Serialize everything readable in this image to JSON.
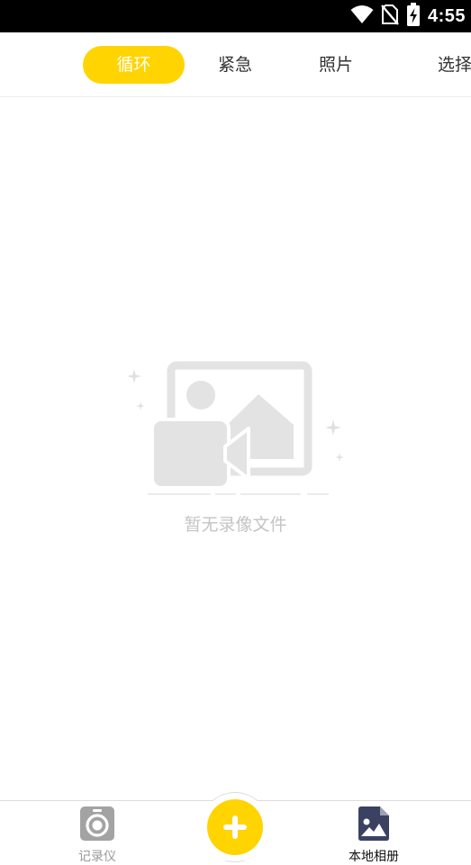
{
  "status_bar": {
    "time": "4:55",
    "icons": [
      "wifi-icon",
      "no-sim-icon",
      "battery-charging-icon"
    ]
  },
  "tabs": [
    {
      "label": "循环",
      "active": true
    },
    {
      "label": "紧急",
      "active": false
    },
    {
      "label": "照片",
      "active": false
    },
    {
      "label": "选择",
      "active": false
    }
  ],
  "empty_state": {
    "icon": "no-video-illustration-icon",
    "text": "暂无录像文件"
  },
  "bottom_nav": {
    "items": [
      {
        "label": "记录仪",
        "icon": "camera-recorder-icon",
        "active": false
      },
      {
        "label": "本地相册",
        "icon": "local-album-icon",
        "active": true
      }
    ],
    "center_button": {
      "icon": "plus-icon"
    }
  },
  "colors": {
    "accent": "#ffd400",
    "tab_text": "#333333",
    "empty_text": "#c4c4c4",
    "nav_inactive": "#999999",
    "nav_active": "#111111",
    "album_icon": "#3b4261"
  }
}
